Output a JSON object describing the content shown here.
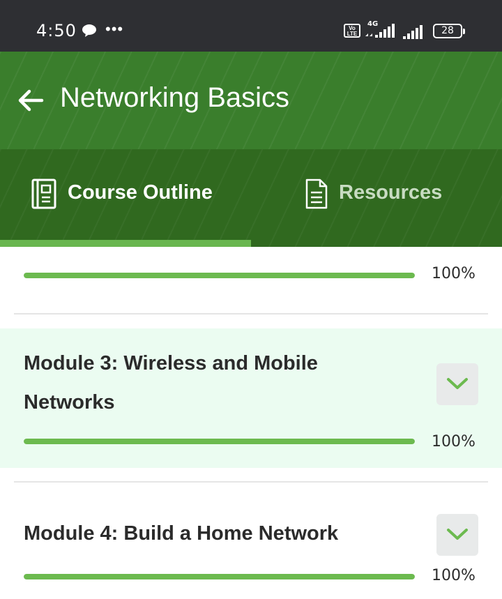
{
  "status_bar": {
    "time": "4:50",
    "more": "•••",
    "volte_line1": "Vo",
    "volte_line2": "LTE",
    "network": "4G",
    "battery": "28"
  },
  "header": {
    "title": "Networking Basics",
    "back_icon": "arrow-left-icon",
    "tabs": [
      {
        "label": "Course Outline",
        "icon": "notebook-icon",
        "active": true
      },
      {
        "label": "Resources",
        "icon": "document-icon",
        "active": false
      }
    ]
  },
  "modules": [
    {
      "title": "",
      "progress": 100,
      "progress_label": "100%"
    },
    {
      "title": "Module 3: Wireless and Mobile Networks",
      "progress": 100,
      "progress_label": "100%",
      "highlighted": true
    },
    {
      "title": "Module 4: Build a Home Network",
      "progress": 100,
      "progress_label": "100%"
    }
  ],
  "colors": {
    "header_green": "#3a7e2c",
    "tab_bar_green": "#30691f",
    "accent_green": "#6cba4f",
    "highlight_bg": "#ebfcf1"
  }
}
